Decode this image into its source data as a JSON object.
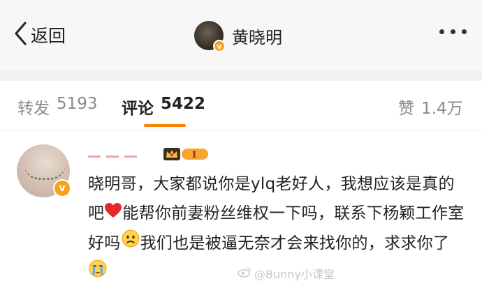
{
  "header": {
    "back_label": "返回",
    "author_name": "黄晓明",
    "author_badge": "v"
  },
  "tabs": [
    {
      "label": "转发",
      "count": "5193",
      "active": false
    },
    {
      "label": "评论",
      "count": "5422",
      "active": true
    },
    {
      "label": "赞",
      "count": "1.4万",
      "active": false
    }
  ],
  "comment": {
    "badge": "v",
    "level_badge": "I",
    "segments": [
      "晓明哥，大家都说你是ylq老好人，我想应该是真的吧",
      "能帮你前妻粉丝维权一下吗，联系下杨颖工作室好吗",
      "我们也是被逼无奈才会来找你的，求求你了"
    ],
    "emojis": [
      "red-heart",
      "worried-face",
      "crying-face"
    ]
  },
  "watermark": "@Bunny小课堂",
  "colors": {
    "accent": "#ff8200",
    "verified": "#f8a21b",
    "heart": "#e8262f"
  }
}
